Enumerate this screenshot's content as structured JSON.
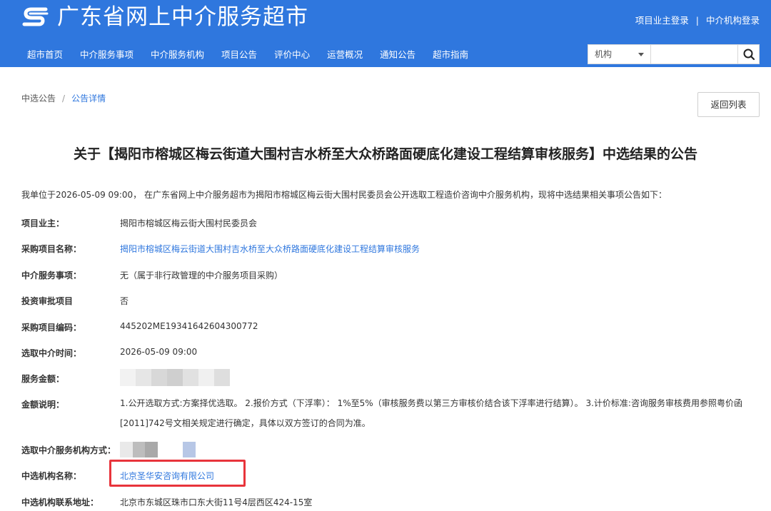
{
  "header": {
    "site_title": "广东省网上中介服务超市",
    "login_owner": "项目业主登录",
    "login_separator": "|",
    "login_agency": "中介机构登录",
    "nav": [
      "超市首页",
      "中介服务事项",
      "中介服务机构",
      "项目公告",
      "评价中心",
      "运营概况",
      "通知公告",
      "超市指南"
    ],
    "search": {
      "select_value": "机构",
      "placeholder": "",
      "icon": "search-icon"
    }
  },
  "breadcrumb": {
    "parent": "中选公告",
    "separator": "/",
    "current": "公告详情"
  },
  "back_button": "返回列表",
  "notice": {
    "title": "关于【揭阳市榕城区梅云街道大围村吉水桥至大众桥路面硬底化建设工程结算审核服务】中选结果的公告",
    "intro": "我单位于2026-05-09 09:00， 在广东省网上中介服务超市为揭阳市榕城区梅云街大围村民委员会公开选取工程造价咨询中介服务机构，现将中选结果相关事项公告如下：",
    "rows": {
      "owner": {
        "label": "项目业主：",
        "value": "揭阳市榕城区梅云街大围村民委员会"
      },
      "project_name": {
        "label": "采购项目名称：",
        "value": "揭阳市榕城区梅云街道大围村吉水桥至大众桥路面硬底化建设工程结算审核服务"
      },
      "service_item": {
        "label": "中介服务事项：",
        "value": "无（属于非行政管理的中介服务项目采购）"
      },
      "investment": {
        "label": "投资审批项目",
        "value": "否"
      },
      "project_code": {
        "label": "采购项目编码：",
        "value": "445202ME19341642604300772"
      },
      "select_time": {
        "label": "选取中介时间：",
        "value": "2026-05-09 09:00"
      },
      "amount": {
        "label": "服务金额："
      },
      "amount_note": {
        "label": "金额说明：",
        "line1": "1.公开选取方式:方案择优选取。 2.报价方式（下浮率）： 1%至5%（审核服务费以第三方审核价结合该下浮率进行结算）。 3.计价标准:咨询服务审核费用参照粤价函",
        "line2": "[2011]742号文相关规定进行确定，具体以双方签订的合同为准。"
      },
      "select_method": {
        "label": "选取中介服务机构方式："
      },
      "winner_name": {
        "label": "中选机构名称：",
        "value": "北京圣华安咨询有限公司"
      },
      "winner_address": {
        "label": "中选机构联系地址：",
        "value": "北京市东城区珠市口东大街11号4层西区424-15室"
      }
    }
  },
  "colors": {
    "header_bg": "#2f77de",
    "link": "#2f77de",
    "highlight_border": "#e8343b",
    "blur1": [
      "#f2f2f2",
      "#e6e6e6",
      "#d8d8d8",
      "#cfcfcf",
      "#e1e1e1",
      "#f0f0f0",
      "#dedede"
    ],
    "blur2": [
      "#e9e9e9",
      "#bdbdbd",
      "#a9a9a9",
      "#ffffff",
      "#ffffff",
      "#b7c7e6"
    ]
  }
}
